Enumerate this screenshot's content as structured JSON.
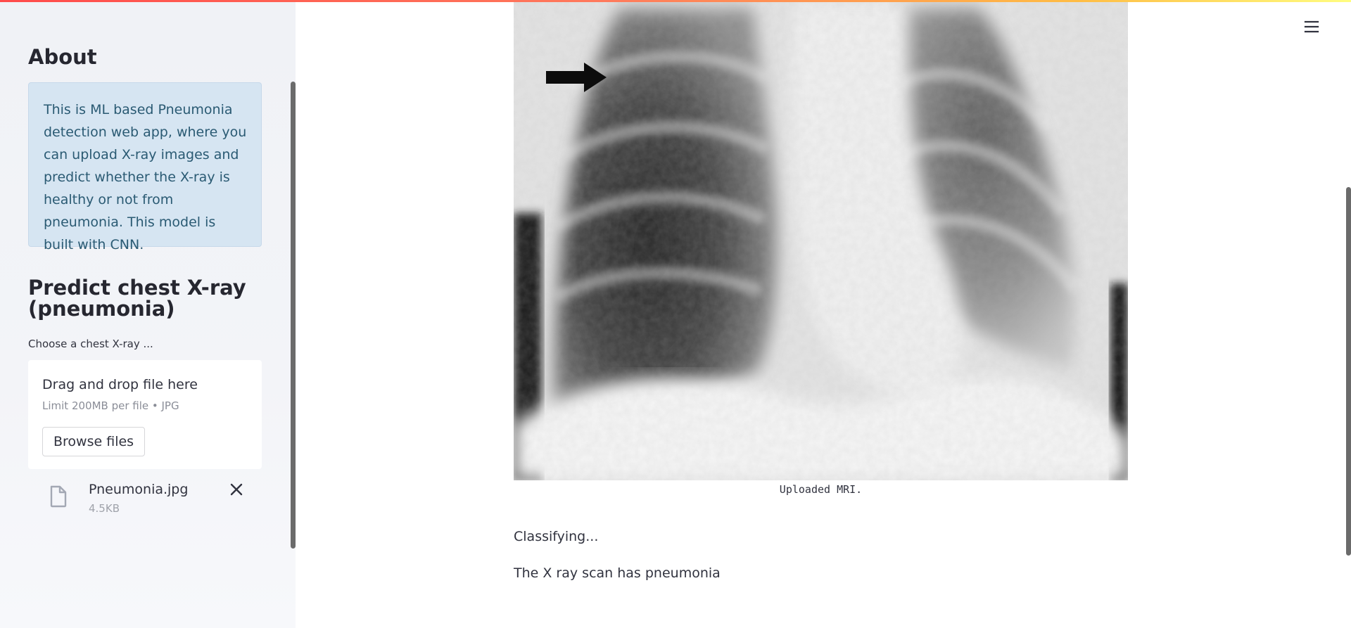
{
  "sidebar": {
    "about_heading": "About",
    "about_text": "This is ML based Pneumonia detection web app, where you can upload X-ray images and predict whether the X-ray is healthy or not from pneumonia. This model is built with CNN.",
    "predict_heading": "Predict chest X-ray (pneumonia)",
    "uploader": {
      "label": "Choose a chest X-ray ...",
      "drag_text": "Drag and drop file here",
      "limit_text": "Limit 200MB per file • JPG",
      "browse_label": "Browse files"
    },
    "uploaded_file": {
      "name": "Pneumonia.jpg",
      "size": "4.5KB",
      "icon": "file-icon",
      "remove_icon": "close-icon"
    }
  },
  "header": {
    "menu_icon": "hamburger-menu-icon"
  },
  "main": {
    "image_caption": "Uploaded MRI.",
    "status_text": "Classifying...",
    "result_text": "The X ray scan has pneumonia"
  },
  "theme": {
    "accent_gradient": [
      "#ff4b4b",
      "#ffbd45",
      "#fffd80"
    ],
    "info_background": "#d6e5f2",
    "info_text": "#2a5a73",
    "sidebar_background": "#f0f2f6"
  }
}
